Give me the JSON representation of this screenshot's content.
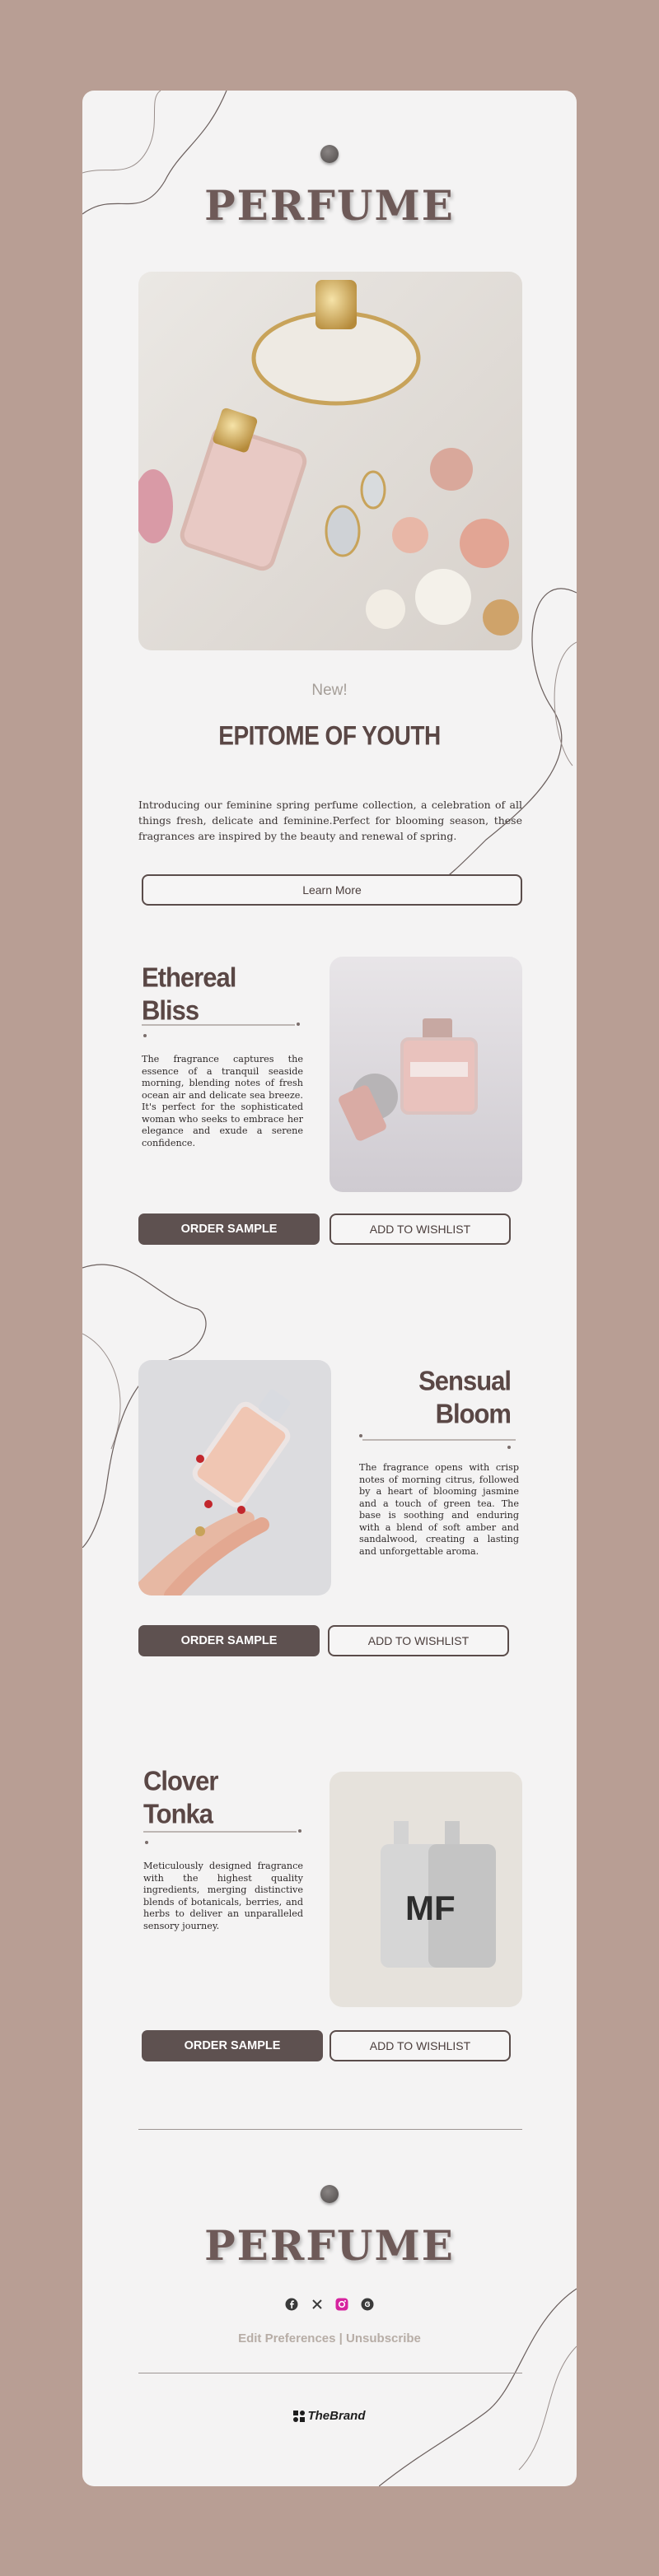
{
  "brand_logo": "PERFUME",
  "hero": {
    "image_alt": "perfume-bottles-with-jewelry",
    "eyebrow": "New!",
    "headline": "EPITOME OF YOUTH",
    "intro": "Introducing our feminine spring perfume collection, a celebration of all things fresh, delicate and feminine.Perfect for blooming season, these fragrances are inspired by the beauty and renewal of spring.",
    "cta": "Learn More"
  },
  "products": [
    {
      "title_line1": "Ethereal",
      "title_line2": "Bliss",
      "description": "The fragrance captures the essence of a tranquil seaside morning, blending notes of fresh ocean air and delicate sea breeze. It's perfect for the sophisticated woman who seeks to embrace her elegance and exude a serene confidence.",
      "order_label": "ORDER SAMPLE",
      "wishlist_label": "ADD TO WISHLIST"
    },
    {
      "title_line1": "Sensual",
      "title_line2": "Bloom",
      "description": "The fragrance opens with crisp notes of morning citrus, followed by a heart of blooming jasmine and a touch of green tea. The base is soothing and enduring with a blend of soft amber and sandalwood, creating a lasting and unforgettable aroma.",
      "order_label": "ORDER SAMPLE",
      "wishlist_label": "ADD TO WISHLIST"
    },
    {
      "title_line1": "Clover",
      "title_line2": "Tonka",
      "description": "Meticulously designed fragrance with the highest quality ingredients, merging distinctive blends of botanicals, berries, and herbs to deliver an unparalleled sensory journey.",
      "order_label": "ORDER SAMPLE",
      "wishlist_label": "ADD TO WISHLIST",
      "bottle_monogram": "MF"
    }
  ],
  "footer": {
    "logo": "PERFUME",
    "social_icons": [
      "facebook-icon",
      "x-icon",
      "instagram-icon",
      "threads-icon"
    ],
    "edit_preferences": "Edit Preferences",
    "separator": "|",
    "unsubscribe": "Unsubscribe",
    "brand_name": "TheBrand"
  },
  "colors": {
    "page_background": "#b89e94",
    "card_background": "#f4f3f3",
    "accent_dark": "#5e5150",
    "heading": "#5a4745"
  }
}
